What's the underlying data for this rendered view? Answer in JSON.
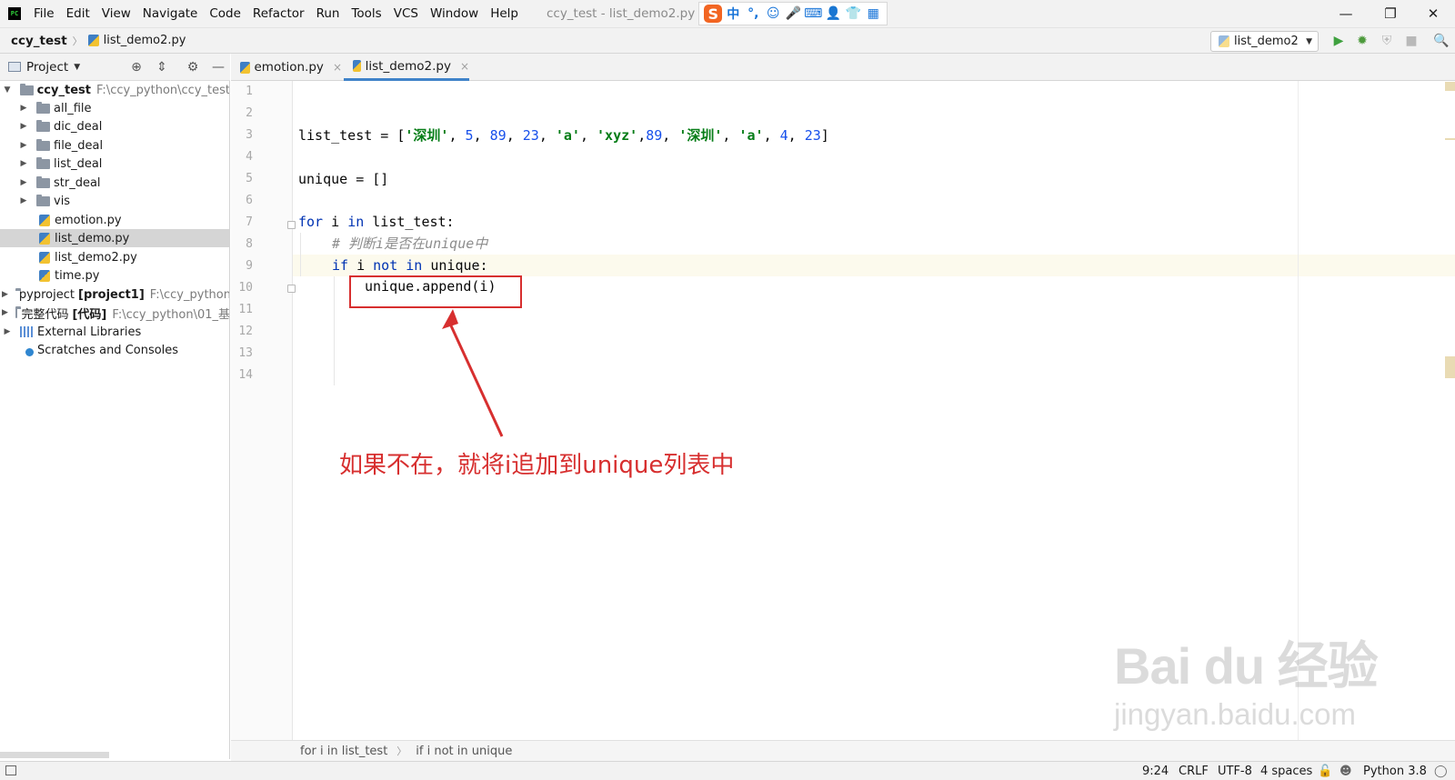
{
  "menu": {
    "items": [
      "File",
      "Edit",
      "View",
      "Navigate",
      "Code",
      "Refactor",
      "Run",
      "Tools",
      "VCS",
      "Window",
      "Help"
    ],
    "window_title": "ccy_test - list_demo2.py"
  },
  "ime": {
    "logo": "S",
    "mode": "中",
    "punct": "°,",
    "emoji": "☺",
    "mic": "🎤",
    "keyboard": "⌨",
    "user": "👤",
    "skin": "👕",
    "grid": "▦"
  },
  "window_controls": {
    "minimize": "—",
    "restore": "❐",
    "close": "✕"
  },
  "navbar": {
    "project": "ccy_test",
    "file": "list_demo2.py",
    "run_config": "list_demo2"
  },
  "project_panel": {
    "title": "Project",
    "tree": [
      {
        "name": "ccy_test",
        "path": "F:\\ccy_python\\ccy_test"
      },
      {
        "name": "all_file"
      },
      {
        "name": "dic_deal"
      },
      {
        "name": "file_deal"
      },
      {
        "name": "list_deal"
      },
      {
        "name": "str_deal"
      },
      {
        "name": "vis"
      },
      {
        "name": "emotion.py"
      },
      {
        "name": "list_demo.py"
      },
      {
        "name": "list_demo2.py"
      },
      {
        "name": "time.py"
      },
      {
        "name": "pyproject",
        "tag": "[project1]",
        "path": "F:\\ccy_python"
      },
      {
        "name": "完整代码",
        "tag": "[代码]",
        "path": "F:\\ccy_python\\01_基"
      },
      {
        "name": "External Libraries"
      },
      {
        "name": "Scratches and Consoles"
      }
    ]
  },
  "tabs": [
    {
      "label": "emotion.py",
      "close": "×"
    },
    {
      "label": "list_demo2.py",
      "close": "×"
    }
  ],
  "editor": {
    "line_numbers": [
      "1",
      "2",
      "3",
      "4",
      "5",
      "6",
      "7",
      "8",
      "9",
      "10",
      "11",
      "12",
      "13",
      "14"
    ],
    "code": {
      "l3": {
        "var": "list_test = [",
        "s1": "'深圳'",
        "c1": ", ",
        "n1": "5",
        "c2": ", ",
        "n2": "89",
        "c3": ", ",
        "n3": "23",
        "c4": ", ",
        "s2": "'a'",
        "c5": ", ",
        "s3": "'xyz'",
        "c6": ",",
        "n4": "89",
        "c7": ", ",
        "s4": "'深圳'",
        "c8": ", ",
        "s5": "'a'",
        "c9": ", ",
        "n5": "4",
        "c10": ", ",
        "n6": "23",
        "end": "]"
      },
      "l5": "unique = []",
      "l7": {
        "kw1": "for",
        "mid1": " i ",
        "kw2": "in",
        "rest": " list_test:"
      },
      "l8": "# 判断i是否在unique中",
      "l9": {
        "kw1": "if",
        "mid1": " i ",
        "kw2": "not",
        "mid2": " ",
        "kw3": "in",
        "rest": " unique:"
      },
      "l10": "unique.append(i)"
    },
    "annotation": "如果不在，就将i追加到unique列表中",
    "annotation_color": "#d72f2f"
  },
  "watermark": {
    "main": "Bai du 经验",
    "sub": "jingyan.baidu.com"
  },
  "code_breadcrumb": [
    "for i in list_test",
    "if i not in unique"
  ],
  "status": {
    "position": "9:24",
    "line_sep": "CRLF",
    "encoding": "UTF-8",
    "indent": "4 spaces",
    "interpreter": "Python 3.8"
  },
  "colors": {
    "keyword": "#0033b3",
    "string": "#067d17",
    "number": "#1750eb",
    "comment": "#8c8c8c",
    "tab_underline": "#4083c9"
  }
}
